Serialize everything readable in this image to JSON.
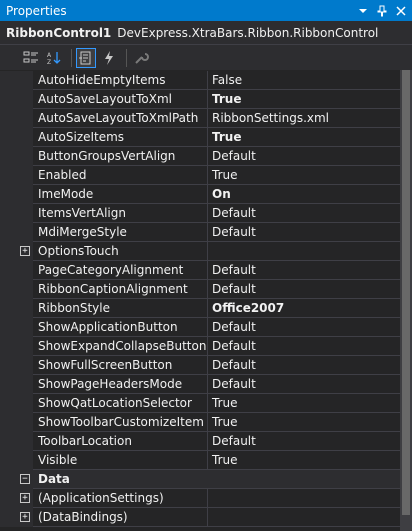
{
  "window": {
    "title": "Properties"
  },
  "object": {
    "name": "RibbonControl1",
    "type": "DevExpress.XtraBars.Ribbon.RibbonControl"
  },
  "properties": [
    {
      "name": "AutoHideEmptyItems",
      "value": "False",
      "bold": false
    },
    {
      "name": "AutoSaveLayoutToXml",
      "value": "True",
      "bold": true
    },
    {
      "name": "AutoSaveLayoutToXmlPath",
      "value": "RibbonSettings.xml",
      "bold": false
    },
    {
      "name": "AutoSizeItems",
      "value": "True",
      "bold": true
    },
    {
      "name": "ButtonGroupsVertAlign",
      "value": "Default",
      "bold": false
    },
    {
      "name": "Enabled",
      "value": "True",
      "bold": false
    },
    {
      "name": "ImeMode",
      "value": "On",
      "bold": true
    },
    {
      "name": "ItemsVertAlign",
      "value": "Default",
      "bold": false
    },
    {
      "name": "MdiMergeStyle",
      "value": "Default",
      "bold": false
    },
    {
      "name": "OptionsTouch",
      "value": "",
      "bold": false,
      "expandable": true
    },
    {
      "name": "PageCategoryAlignment",
      "value": "Default",
      "bold": false
    },
    {
      "name": "RibbonCaptionAlignment",
      "value": "Default",
      "bold": false
    },
    {
      "name": "RibbonStyle",
      "value": "Office2007",
      "bold": true
    },
    {
      "name": "ShowApplicationButton",
      "value": "Default",
      "bold": false
    },
    {
      "name": "ShowExpandCollapseButton",
      "value": "Default",
      "bold": false
    },
    {
      "name": "ShowFullScreenButton",
      "value": "Default",
      "bold": false
    },
    {
      "name": "ShowPageHeadersMode",
      "value": "Default",
      "bold": false
    },
    {
      "name": "ShowQatLocationSelector",
      "value": "True",
      "bold": false
    },
    {
      "name": "ShowToolbarCustomizeItem",
      "value": "True",
      "bold": false
    },
    {
      "name": "ToolbarLocation",
      "value": "Default",
      "bold": false
    },
    {
      "name": "Visible",
      "value": "True",
      "bold": false
    }
  ],
  "categories": [
    {
      "name": "Data"
    }
  ],
  "data_properties": [
    {
      "name": "(ApplicationSettings)",
      "value": "",
      "expandable": true
    },
    {
      "name": "(DataBindings)",
      "value": "",
      "expandable": true
    }
  ],
  "expander_symbols": {
    "collapsed": "+",
    "expanded": "−"
  },
  "colors": {
    "title_bar": "#007acc",
    "background": "#252526",
    "panel": "#2d2d30",
    "grid_line": "#3f3f46",
    "text": "#f1f1f1"
  }
}
